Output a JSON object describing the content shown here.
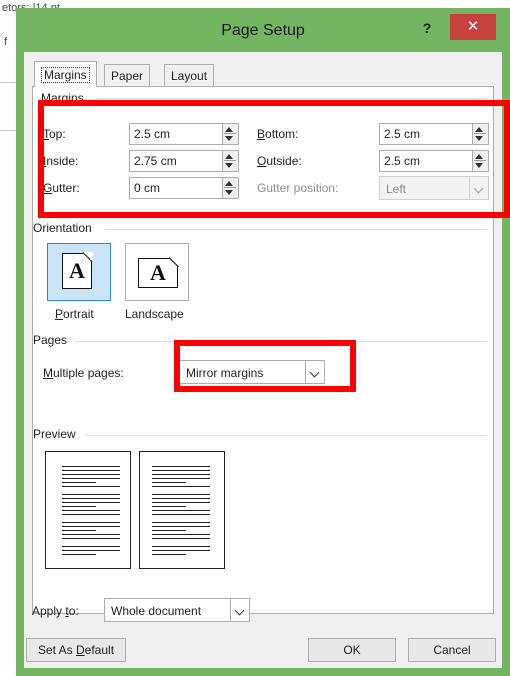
{
  "background": {
    "fragment_1": "etors: |14 pt",
    "fragment_2": "f"
  },
  "dialog": {
    "title": "Page Setup",
    "help_label": "?",
    "close_label": "✕"
  },
  "tabs": [
    {
      "label": "Margins",
      "active": true
    },
    {
      "label": "Paper",
      "active": false
    },
    {
      "label": "Layout",
      "active": false
    }
  ],
  "margins": {
    "group_label": "Margins",
    "top": {
      "label": "Top:",
      "value": "2.5 cm"
    },
    "bottom": {
      "label": "Bottom:",
      "value": "2.5 cm"
    },
    "inside": {
      "label": "Inside:",
      "value": "2.75 cm"
    },
    "outside": {
      "label": "Outside:",
      "value": "2.5 cm"
    },
    "gutter": {
      "label": "Gutter:",
      "value": "0 cm"
    },
    "gutter_position": {
      "label": "Gutter position:",
      "value": "Left",
      "disabled": true
    }
  },
  "orientation": {
    "group_label": "Orientation",
    "portrait": {
      "label": "Portrait",
      "glyph": "A",
      "selected": true
    },
    "landscape": {
      "label": "Landscape",
      "glyph": "A",
      "selected": false
    }
  },
  "pages": {
    "group_label": "Pages",
    "multiple_label": "Multiple pages:",
    "multiple_value": "Mirror margins"
  },
  "preview": {
    "group_label": "Preview"
  },
  "apply_to": {
    "label": "Apply to:",
    "value": "Whole document"
  },
  "buttons": {
    "set_default": "Set As Default",
    "ok": "OK",
    "cancel": "Cancel"
  },
  "colors": {
    "highlight": "#ff0000",
    "dialog_frame": "#73b560",
    "close": "#c7403b"
  },
  "icons": [
    "spin-up-icon",
    "spin-down-icon",
    "chevron-down-icon",
    "portrait-page-icon",
    "landscape-page-icon",
    "close-icon",
    "help-icon"
  ]
}
